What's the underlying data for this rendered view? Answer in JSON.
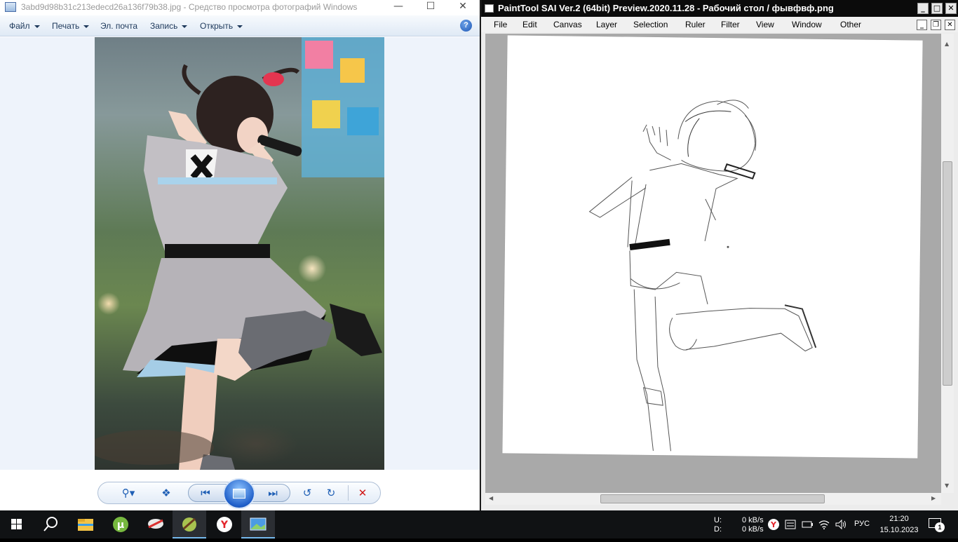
{
  "viewer": {
    "title": "3abd9d98b31c213edecd26a136f79b38.jpg - Средство просмотра фотографий Windows",
    "menu": [
      {
        "label": "Файл",
        "dropdown": true
      },
      {
        "label": "Печать",
        "dropdown": true
      },
      {
        "label": "Эл. почта",
        "dropdown": false
      },
      {
        "label": "Запись",
        "dropdown": true
      },
      {
        "label": "Открыть",
        "dropdown": true
      }
    ],
    "help_label": "?",
    "toolbar_icons": [
      "zoom-icon",
      "actual-size-icon",
      "previous-icon",
      "slideshow-icon",
      "next-icon",
      "rotate-left-icon",
      "rotate-right-icon",
      "delete-icon"
    ]
  },
  "sai": {
    "title": "PaintTool SAI Ver.2 (64bit) Preview.2020.11.28 - Рабочий стол / фывфвф.png",
    "menu": [
      "File",
      "Edit",
      "Canvas",
      "Layer",
      "Selection",
      "Ruler",
      "Filter",
      "View",
      "Window",
      "Other"
    ]
  },
  "taskbar": {
    "apps": [
      "start-icon",
      "search-icon",
      "file-explorer-icon",
      "utorrent-icon",
      "app-icon",
      "painttool-sai-icon",
      "yandex-browser-icon",
      "photo-viewer-icon"
    ],
    "upload_label": "U:",
    "download_label": "D:",
    "upload_speed": "0 kB/s",
    "download_speed": "0 kB/s",
    "language": "РУС",
    "time": "21:20",
    "date": "15.10.2023",
    "notifications": "1"
  }
}
